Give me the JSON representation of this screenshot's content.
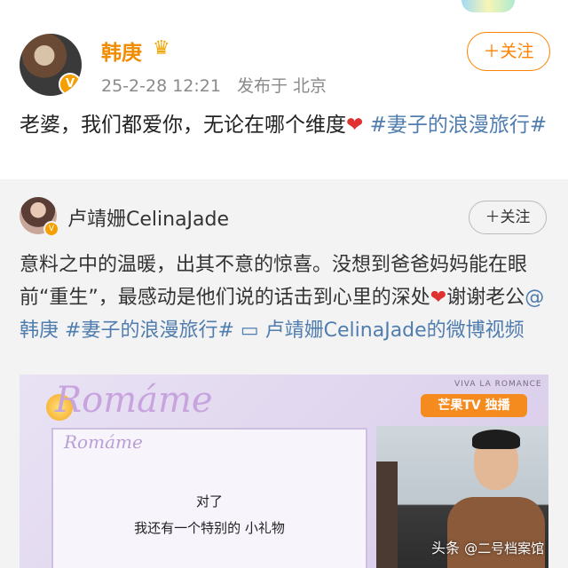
{
  "post": {
    "author": "韩庚",
    "crown_icon": "crown-icon",
    "date": "25-2-28 12:21",
    "source": "发布于 北京",
    "follow_label": "＋关注",
    "text_main": "老婆，我们都爱你，无论在哪个维度",
    "heart": "❤",
    "hashtag": "#妻子的浪漫旅行#"
  },
  "repost": {
    "author": "卢靖姗CelinaJade",
    "follow_label": "＋关注",
    "text_part1": "意料之中的温暖，出其不意的惊喜。没想到爸爸妈妈能在眼前“重生”，最感动是他们说的话击到心里的深处",
    "heart": "❤",
    "text_part2": "谢谢老公",
    "mention": "@韩庚",
    "hashtag": " #妻子的浪漫旅行#",
    "video_link": " 卢靖姗CelinaJade的微博视频"
  },
  "video": {
    "show_logo_big": "Romáme",
    "show_logo_small": "Romáme",
    "viva_text": "VIVA LA ROMANCE",
    "tv_logo": "芒果TV 独播",
    "subtitle_1": "对了",
    "subtitle_2": "我还有一个特别的 小礼物"
  },
  "watermark": {
    "prefix": "头条",
    "handle": "@二号档案馆"
  },
  "colors": {
    "author_orange": "#f08c00",
    "follow_orange": "#ff8200",
    "link_blue": "#507daf",
    "heart_red": "#e03131"
  }
}
